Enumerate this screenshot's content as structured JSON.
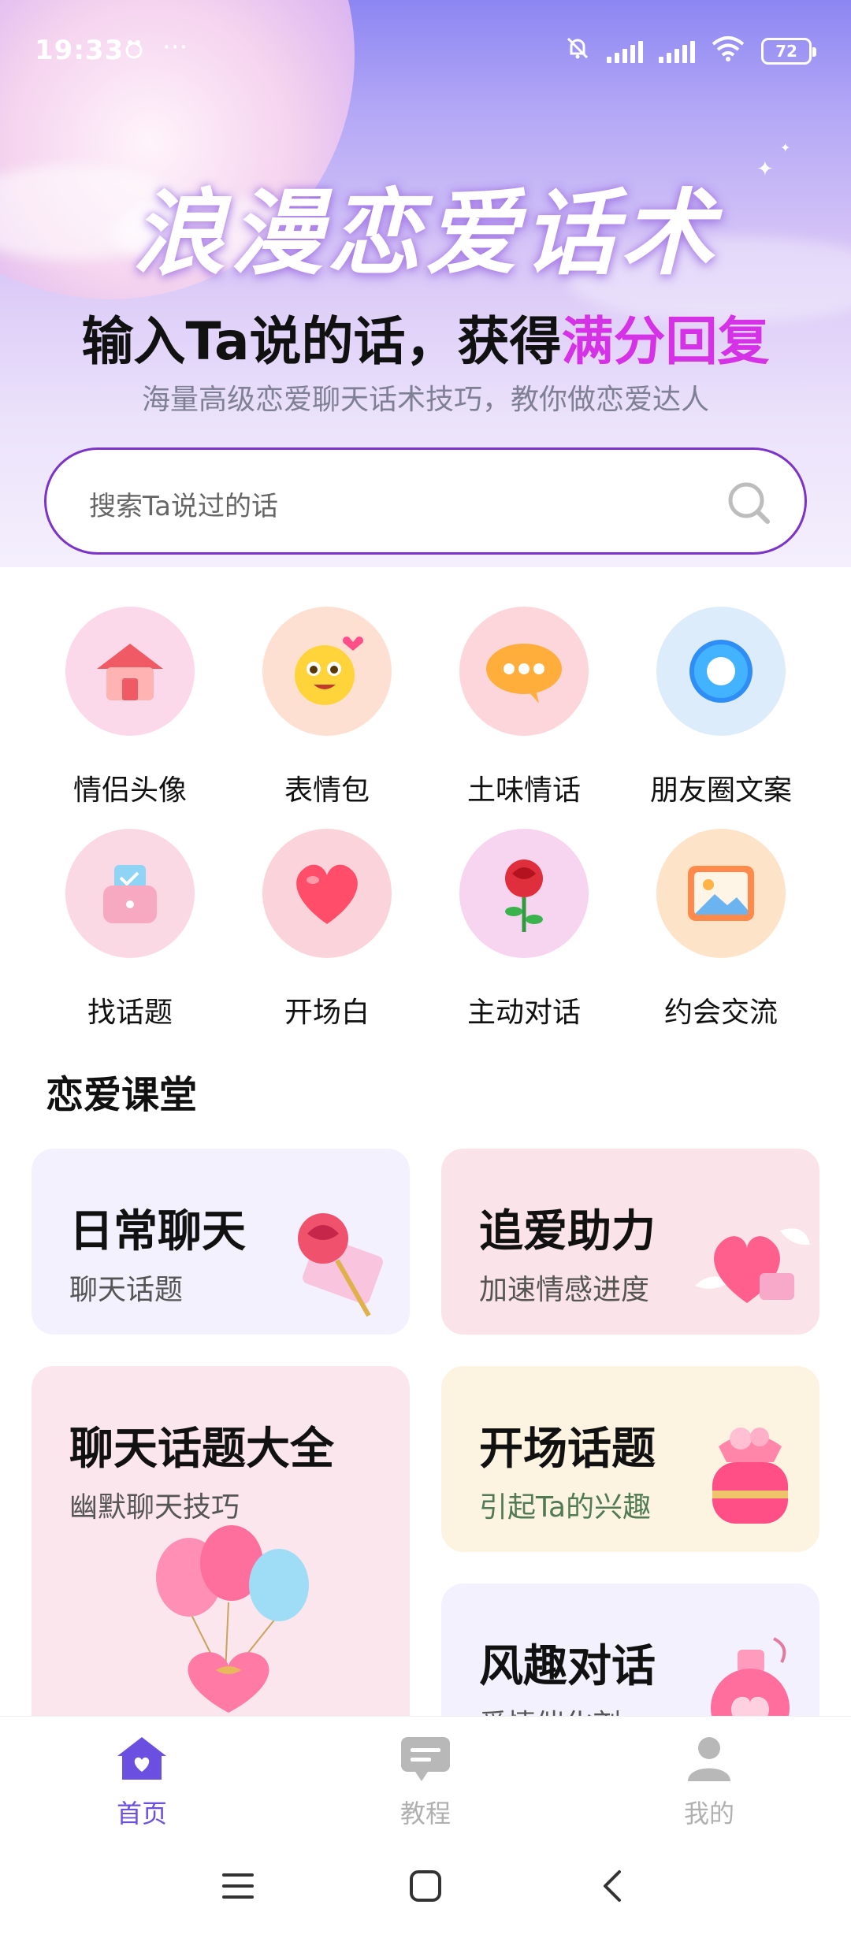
{
  "status_bar": {
    "time": "19:33",
    "dots": "···",
    "battery": "72"
  },
  "hero": {
    "logo_text": "浪漫恋爱话术",
    "headline_prefix": "输入Ta说的话，获得",
    "headline_highlight": "满分回复",
    "subline": "海量高级恋爱聊天话术技巧，教你做恋爱达人",
    "highlight_color": "#d531e6"
  },
  "search": {
    "placeholder": "搜索Ta说过的话",
    "border_color": "#7b33c8"
  },
  "categories": [
    {
      "label": "情侣头像",
      "icon": "house-icon"
    },
    {
      "label": "表情包",
      "icon": "emoji-face-icon"
    },
    {
      "label": "土味情话",
      "icon": "chat-bubble-icon"
    },
    {
      "label": "朋友圈文案",
      "icon": "ring-icon"
    },
    {
      "label": "找话题",
      "icon": "wallet-icon"
    },
    {
      "label": "开场白",
      "icon": "heart-icon"
    },
    {
      "label": "主动对话",
      "icon": "rose-icon"
    },
    {
      "label": "约会交流",
      "icon": "picture-icon"
    }
  ],
  "section": {
    "title": "恋爱课堂"
  },
  "cards": [
    {
      "title": "日常聊天",
      "subtitle": "聊天话题",
      "icon": "rose-envelope-icon"
    },
    {
      "title": "追爱助力",
      "subtitle": "加速情感进度",
      "icon": "winged-heart-icon"
    },
    {
      "title": "聊天话题大全",
      "subtitle": "幽默聊天技巧",
      "icon": "balloons-icon"
    },
    {
      "title": "开场话题",
      "subtitle": "引起Ta的兴趣",
      "icon": "gift-bag-icon"
    },
    {
      "title": "风趣对话",
      "subtitle": "爱情催化剂",
      "icon": "potion-icon"
    }
  ],
  "bottom_nav": [
    {
      "label": "首页",
      "icon": "home-icon",
      "active": true
    },
    {
      "label": "教程",
      "icon": "message-icon",
      "active": false
    },
    {
      "label": "我的",
      "icon": "profile-icon",
      "active": false
    }
  ],
  "colors": {
    "accent": "#6a4fe0",
    "inactive": "#b5b5b5"
  }
}
